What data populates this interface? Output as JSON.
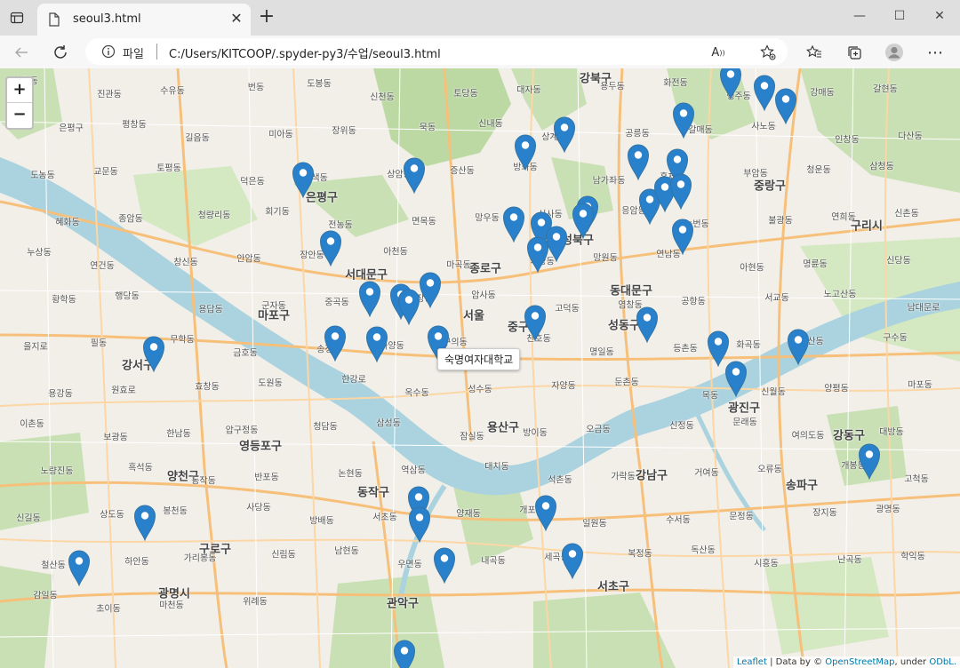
{
  "tab": {
    "title": "seoul3.html"
  },
  "address_bar": {
    "label": "파일",
    "url": "C:/Users/KITCOOP/.spyder-py3/수업/seoul3.html"
  },
  "map": {
    "zoom_in": "+",
    "zoom_out": "−",
    "tooltip": "숙명여자대학교",
    "attribution": {
      "leaflet": "Leaflet",
      "data_by": " | Data by © ",
      "osm": "OpenStreetMap",
      "under": ", under ",
      "odbl": "ODbL."
    },
    "district_labels": [
      "강북구",
      "은평구",
      "서대문구",
      "종로구",
      "중랑구",
      "구리시",
      "마포구",
      "서울",
      "동대문구",
      "성동구",
      "광진구",
      "강서구",
      "영등포구",
      "용산구",
      "중구",
      "강동구",
      "양천구",
      "동작구",
      "강남구",
      "송파구",
      "구로구",
      "광명시",
      "관악구",
      "서초구",
      "성북구"
    ],
    "place_labels": [
      "화정동",
      "진관동",
      "수유동",
      "번동",
      "도봉동",
      "신천동",
      "토당동",
      "대자동",
      "용두동",
      "화전동",
      "행주동",
      "강매동",
      "갈현동",
      "은평구",
      "평창동",
      "길음동",
      "미아동",
      "장위동",
      "묵동",
      "신내동",
      "상계동",
      "공릉동",
      "갈매동",
      "사노동",
      "인창동",
      "다산동",
      "도농동",
      "교문동",
      "토평동",
      "덕은동",
      "수색동",
      "상암동",
      "증산동",
      "방화동",
      "남가좌동",
      "홍제동",
      "부암동",
      "청운동",
      "삼청동",
      "혜화동",
      "종암동",
      "청량리동",
      "회기동",
      "전농동",
      "면목동",
      "망우동",
      "신사동",
      "응암동",
      "녹번동",
      "불광동",
      "연희동",
      "신촌동",
      "누상동",
      "연건동",
      "창신동",
      "안암동",
      "장안동",
      "아천동",
      "마곡동",
      "가양동",
      "망원동",
      "연남동",
      "아현동",
      "명륜동",
      "신당동",
      "황학동",
      "행당동",
      "용답동",
      "군자동",
      "중곡동",
      "광장동",
      "암사동",
      "고덕동",
      "염창동",
      "공항동",
      "서교동",
      "노고산동",
      "남대문로",
      "을지로",
      "필동",
      "무학동",
      "금호동",
      "송정동",
      "화양동",
      "구의동",
      "천호동",
      "명일동",
      "등촌동",
      "화곡동",
      "당산동",
      "구수동",
      "용강동",
      "원효로",
      "효창동",
      "도원동",
      "한강로",
      "옥수동",
      "성수동",
      "자양동",
      "둔촌동",
      "목동",
      "신월동",
      "양평동",
      "마포동",
      "이촌동",
      "보광동",
      "한남동",
      "압구정동",
      "청담동",
      "삼성동",
      "잠실동",
      "방이동",
      "오금동",
      "신정동",
      "문래동",
      "여의도동",
      "대방동",
      "노량진동",
      "흑석동",
      "동작동",
      "반포동",
      "논현동",
      "역삼동",
      "대치동",
      "석촌동",
      "가락동",
      "거여동",
      "오류동",
      "개봉동",
      "고척동",
      "신길동",
      "상도동",
      "봉천동",
      "사당동",
      "방배동",
      "서초동",
      "양재동",
      "개포동",
      "일원동",
      "수서동",
      "문정동",
      "장지동",
      "광명동",
      "철산동",
      "하안동",
      "가리봉동",
      "신림동",
      "남현동",
      "우면동",
      "내곡동",
      "세곡동",
      "복정동",
      "독산동",
      "시흥동",
      "난곡동",
      "학익동",
      "감일동",
      "초이동",
      "마천동",
      "위례동"
    ]
  },
  "colors": {
    "marker": "#2a81cb",
    "park": "#c8e0b4",
    "water": "#aad3df",
    "road_major": "#f7c07a",
    "road_minor": "#ffffff"
  }
}
